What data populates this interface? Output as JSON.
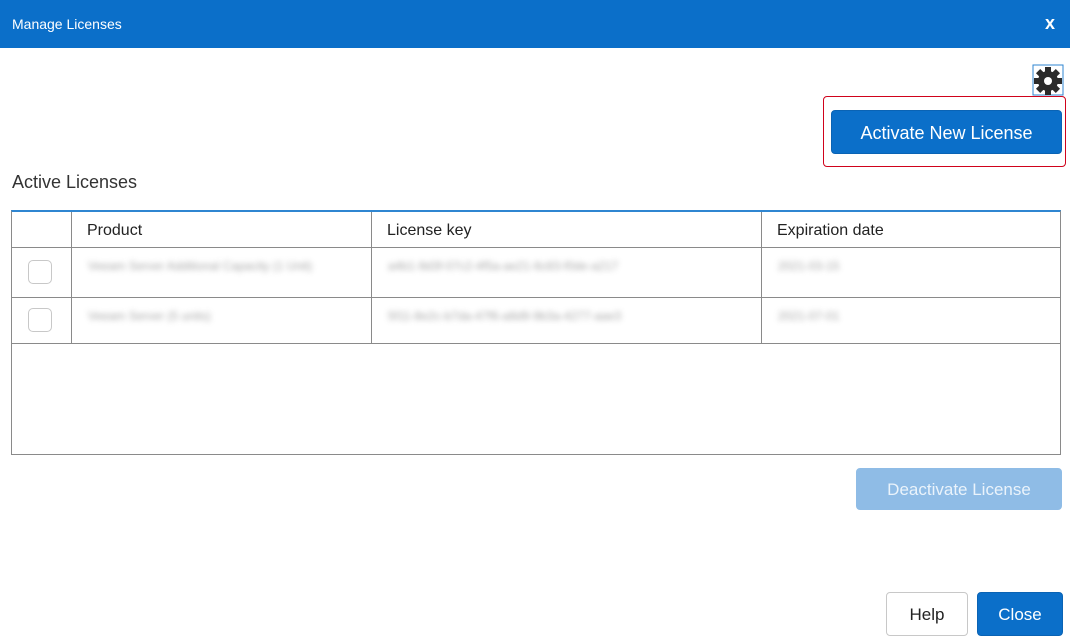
{
  "window": {
    "title": "Manage Licenses",
    "close_glyph": "x"
  },
  "toolbar": {
    "settings_icon": "gear-icon",
    "activate_label": "Activate New License"
  },
  "section": {
    "title": "Active Licenses"
  },
  "table": {
    "columns": [
      "Product",
      "License key",
      "Expiration date"
    ],
    "rows": [
      {
        "checked": false,
        "product": "Veeam Server Additional Capacity (1 Unit)",
        "license_key": "a4b1-9d3f-07c2-4f5a-ae21-6c83-f0de-a217",
        "expiration": "2021-03-15"
      },
      {
        "checked": false,
        "product": "Veeam Server (5 units)",
        "license_key": "5f11-8e2c-b7da-47f6-a8d9-9b3a-4277-aae3",
        "expiration": "2021-07-01"
      }
    ]
  },
  "actions": {
    "deactivate_label": "Deactivate License",
    "help_label": "Help",
    "close_label": "Close"
  },
  "colors": {
    "primary": "#0b6fc9",
    "disabled": "#8fbce6",
    "highlight": "#d0021b",
    "grid_accent": "#2f86d1"
  }
}
